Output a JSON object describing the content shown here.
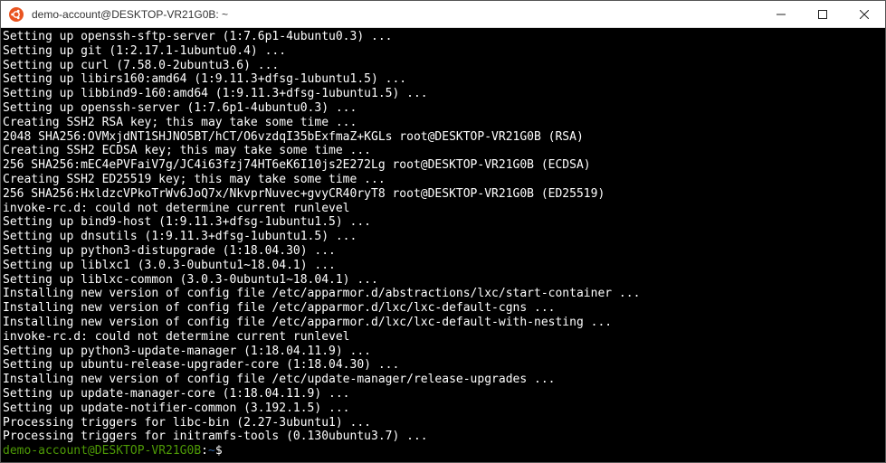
{
  "titlebar": {
    "icon_name": "ubuntu-icon",
    "title": "demo-account@DESKTOP-VR21G0B: ~"
  },
  "window_controls": {
    "minimize": "minimize",
    "maximize": "maximize",
    "close": "close"
  },
  "terminal": {
    "lines": [
      "Setting up openssh-sftp-server (1:7.6p1-4ubuntu0.3) ...",
      "Setting up git (1:2.17.1-1ubuntu0.4) ...",
      "Setting up curl (7.58.0-2ubuntu3.6) ...",
      "Setting up libirs160:amd64 (1:9.11.3+dfsg-1ubuntu1.5) ...",
      "Setting up libbind9-160:amd64 (1:9.11.3+dfsg-1ubuntu1.5) ...",
      "Setting up openssh-server (1:7.6p1-4ubuntu0.3) ...",
      "Creating SSH2 RSA key; this may take some time ...",
      "2048 SHA256:OVMxjdNT1SHJNO5BT/hCT/O6vzdqI35bExfmaZ+KGLs root@DESKTOP-VR21G0B (RSA)",
      "Creating SSH2 ECDSA key; this may take some time ...",
      "256 SHA256:mEC4ePVFaiV7g/JC4i63fzj74HT6eK6I10js2E272Lg root@DESKTOP-VR21G0B (ECDSA)",
      "Creating SSH2 ED25519 key; this may take some time ...",
      "256 SHA256:HxldzcVPkoTrWv6JoQ7x/NkvprNuvec+gvyCR40ryT8 root@DESKTOP-VR21G0B (ED25519)",
      "invoke-rc.d: could not determine current runlevel",
      "Setting up bind9-host (1:9.11.3+dfsg-1ubuntu1.5) ...",
      "Setting up dnsutils (1:9.11.3+dfsg-1ubuntu1.5) ...",
      "Setting up python3-distupgrade (1:18.04.30) ...",
      "Setting up liblxc1 (3.0.3-0ubuntu1~18.04.1) ...",
      "Setting up liblxc-common (3.0.3-0ubuntu1~18.04.1) ...",
      "Installing new version of config file /etc/apparmor.d/abstractions/lxc/start-container ...",
      "Installing new version of config file /etc/apparmor.d/lxc/lxc-default-cgns ...",
      "Installing new version of config file /etc/apparmor.d/lxc/lxc-default-with-nesting ...",
      "invoke-rc.d: could not determine current runlevel",
      "Setting up python3-update-manager (1:18.04.11.9) ...",
      "Setting up ubuntu-release-upgrader-core (1:18.04.30) ...",
      "Installing new version of config file /etc/update-manager/release-upgrades ...",
      "Setting up update-manager-core (1:18.04.11.9) ...",
      "Setting up update-notifier-common (3.192.1.5) ...",
      "Processing triggers for libc-bin (2.27-3ubuntu1) ...",
      "Processing triggers for initramfs-tools (0.130ubuntu3.7) ..."
    ],
    "prompt": {
      "user": "demo-account",
      "at": "@",
      "host": "DESKTOP-VR21G0B",
      "colon": ":",
      "path": "~",
      "dollar": "$"
    }
  }
}
